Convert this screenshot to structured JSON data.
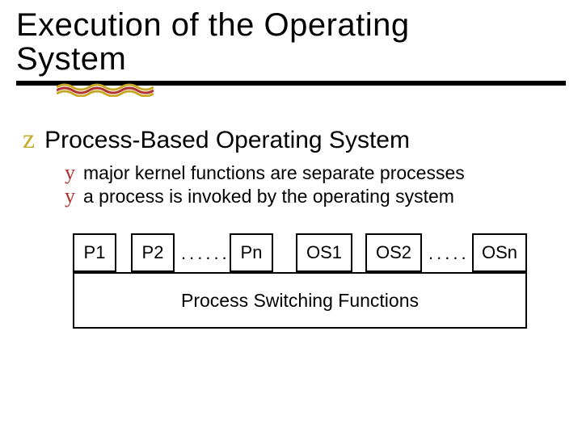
{
  "title_line1": "Execution of the Operating",
  "title_line2": "System",
  "main_bullet": "Process-Based Operating System",
  "sub_bullets": [
    "major kernel functions are separate processes",
    "a process is invoked by the operating system"
  ],
  "diagram": {
    "p1": "P1",
    "p2": "P2",
    "dots1": "......",
    "pn": "Pn",
    "os1": "OS1",
    "os2": "OS2",
    "dots2": ".....",
    "osn": "OSn",
    "footer": "Process Switching  Functions"
  }
}
